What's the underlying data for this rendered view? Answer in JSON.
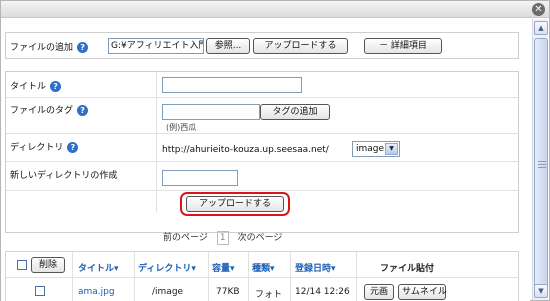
{
  "window": {
    "close_glyph": "✕"
  },
  "upload_form": {
    "file_add": {
      "label": "ファイルの追加",
      "file_value": "G:¥アフィリエイト入門¥",
      "browse_label": "参照...",
      "upload_label": "アップロードする",
      "details_label": "－ 詳細項目"
    },
    "title": {
      "label": "タイトル",
      "value": ""
    },
    "file_tags": {
      "label": "ファイルのタグ",
      "value": "",
      "add_tag_label": "タグの追加",
      "example_text": "(例)西瓜"
    },
    "directory": {
      "label": "ディレクトリ",
      "base_url": "http://ahurieito-kouza.up.seesaa.net/",
      "selected": "image"
    },
    "new_directory": {
      "label": "新しいディレクトリの作成",
      "value": ""
    },
    "submit_label": "アップロードする",
    "help_glyph": "?"
  },
  "pagination": {
    "prev": "前のページ",
    "current": "1",
    "next": "次のページ"
  },
  "file_table": {
    "delete_label": "削除",
    "columns": [
      "タイトル▾",
      "ディレクトリ▾",
      "容量▾",
      "種類▾",
      "登録日時▾",
      "ファイル貼付"
    ],
    "rows": [
      {
        "title": "ama.jpg",
        "directory": "/image",
        "size": "77KB",
        "type": "フォト",
        "date": "12/14 12:26",
        "paste_original": "元画",
        "paste_thumbnail": "サムネイル"
      }
    ]
  },
  "colors": {
    "highlight": "#d81818",
    "link": "#1a5fb4",
    "help_icon": "#2f6fc6"
  }
}
